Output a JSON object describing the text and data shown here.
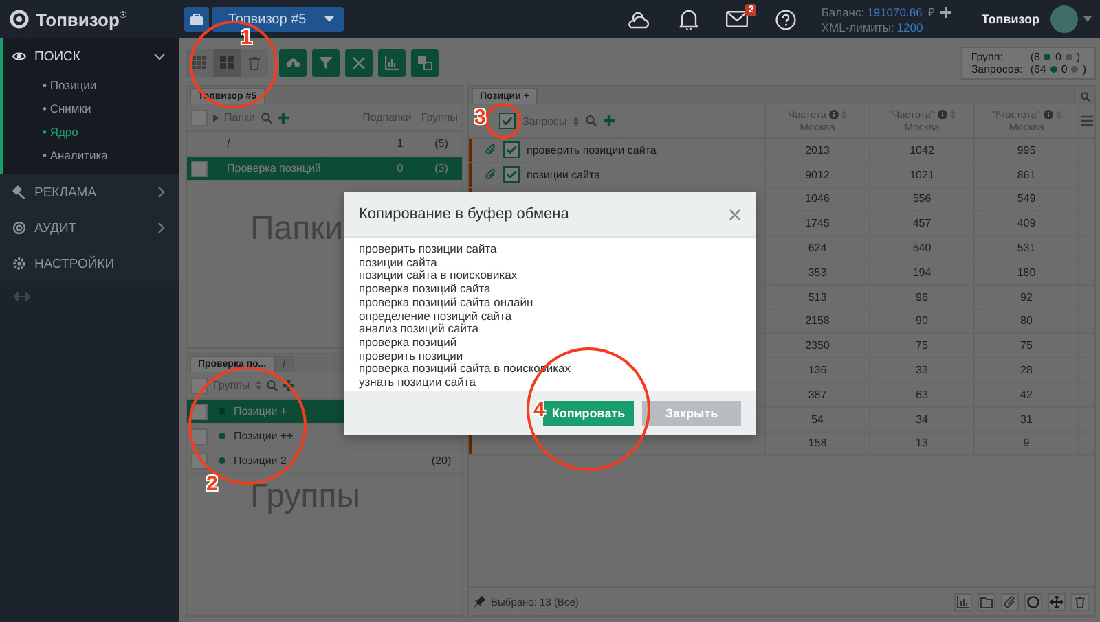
{
  "topbar": {
    "logo": "Топвизор",
    "logo_mark": "®",
    "project": "Топвизор #5",
    "mail_count": "2",
    "balance_label": "Баланс:",
    "balance": "191070.86",
    "currency": "₽",
    "xml_label": "XML-лимиты:",
    "xml_limit": "1200",
    "user": "Топвизор"
  },
  "sidebar": {
    "sections": [
      {
        "label": "ПОИСК",
        "kind": "search",
        "expanded": true,
        "children": [
          {
            "label": "• Позиции",
            "selected": false
          },
          {
            "label": "• Снимки",
            "selected": false
          },
          {
            "label": "• Ядро",
            "selected": true
          },
          {
            "label": "• Аналитика",
            "selected": false
          }
        ]
      },
      {
        "label": "РЕКЛАМА",
        "kind": "ads",
        "expanded": false
      },
      {
        "label": "АУДИТ",
        "kind": "audit",
        "expanded": false
      },
      {
        "label": "НАСТРОЙКИ",
        "kind": "settings"
      }
    ]
  },
  "toolbar": {
    "view_buttons": [
      {
        "kind": "grid",
        "selected": false
      },
      {
        "kind": "tiles",
        "selected": true
      },
      {
        "kind": "trash",
        "selected": false
      }
    ],
    "action_buttons": [
      {
        "kind": "cloud"
      },
      {
        "kind": "filter"
      },
      {
        "kind": "shrink"
      },
      {
        "kind": "chart"
      },
      {
        "kind": "translate"
      }
    ]
  },
  "stats": [
    {
      "label": "Групп:",
      "active": "(8",
      "inactive": "0",
      "close": ")"
    },
    {
      "label": "Запросов:",
      "active": "(64",
      "inactive": "0",
      "close": ")"
    }
  ],
  "folders": {
    "tab": "Топвизор #5",
    "title": "Папки",
    "checked": false,
    "col_subfolders": "Подпапки",
    "col_groups": "Группы",
    "rows": [
      {
        "kind": "root",
        "name": "/",
        "subfolders": "1",
        "groups": "(5)",
        "selected": false
      },
      {
        "kind": "folder",
        "name": "Проверка позиций",
        "subfolders": "0",
        "groups": "(3)",
        "selected": true
      }
    ],
    "background_label": "Папки"
  },
  "groups": {
    "tabs": [
      {
        "label": "Проверка по...",
        "selected": true
      },
      {
        "label": "/",
        "selected": false
      }
    ],
    "title": "Группы",
    "checked": false,
    "rows": [
      {
        "name": "Позиции +",
        "selected": true
      },
      {
        "name": "Позиции ++",
        "selected": false
      },
      {
        "name": "Позиции 2",
        "count": "(20)",
        "selected": false
      }
    ],
    "background_label": "Группы"
  },
  "queries": {
    "tab": "Позиции +",
    "title": "Запросы",
    "checked": true,
    "columns": [
      {
        "title": "Частота",
        "region": "Москва"
      },
      {
        "title": "\"Частота\"",
        "region": "Москва"
      },
      {
        "title": "\"!Частота\"",
        "region": "Москва"
      }
    ],
    "rows": [
      {
        "query": "проверить позиции сайта",
        "checked": true,
        "values": [
          "2013",
          "1042",
          "995"
        ]
      },
      {
        "query": "позиции сайта",
        "checked": true,
        "values": [
          "9012",
          "1021",
          "861"
        ]
      },
      {
        "values": [
          "1046",
          "556",
          "549"
        ]
      },
      {
        "values": [
          "1745",
          "457",
          "409"
        ]
      },
      {
        "values": [
          "624",
          "540",
          "531"
        ]
      },
      {
        "values": [
          "353",
          "194",
          "180"
        ]
      },
      {
        "values": [
          "513",
          "96",
          "92"
        ]
      },
      {
        "values": [
          "2158",
          "90",
          "80"
        ]
      },
      {
        "values": [
          "2350",
          "75",
          "75"
        ]
      },
      {
        "values": [
          "136",
          "33",
          "28"
        ]
      },
      {
        "values": [
          "387",
          "63",
          "42"
        ]
      },
      {
        "values": [
          "54",
          "34",
          "31"
        ]
      },
      {
        "values": [
          "158",
          "13",
          "9"
        ]
      }
    ],
    "selected_text": "Выбрано: 13 (Все)",
    "footer_buttons": [
      {
        "kind": "chart"
      },
      {
        "kind": "folder"
      },
      {
        "kind": "clip"
      },
      {
        "kind": "circle"
      },
      {
        "kind": "move"
      },
      {
        "kind": "trash"
      }
    ]
  },
  "modal": {
    "title": "Копирование в буфер обмена",
    "lines": [
      "проверить позиции сайта",
      "позиции сайта",
      "позиции сайта в поисковиках",
      "проверка позиций сайта",
      "проверка позиций сайта онлайн",
      "определение позиций сайта",
      "анализ позиций сайта",
      "проверка позиций",
      "проверить позиции",
      "проверка позиций сайта в поисковиках",
      "узнать позиции сайта"
    ],
    "buttons": [
      {
        "label": "Копировать",
        "kind": "primary"
      },
      {
        "label": "Закрыть",
        "kind": "secondary"
      }
    ]
  },
  "annotations": [
    {
      "number": "1"
    },
    {
      "number": "2"
    },
    {
      "number": "3"
    },
    {
      "number": "4"
    }
  ]
}
